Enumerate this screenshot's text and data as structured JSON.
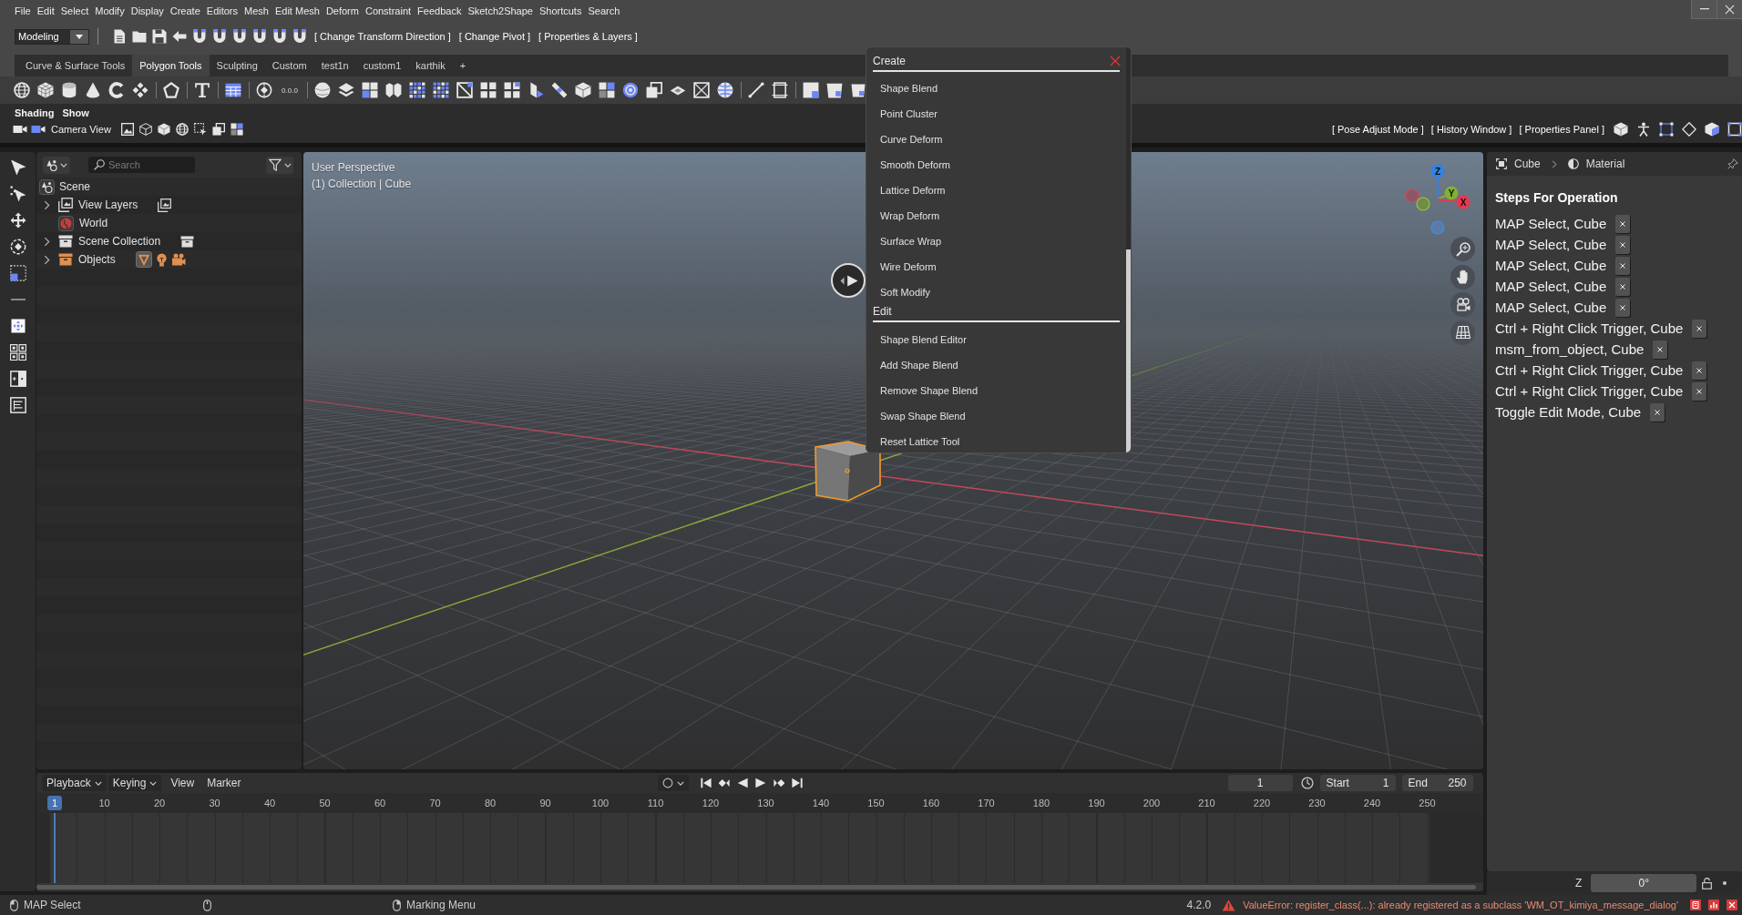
{
  "menu_bar": {
    "items": [
      "File",
      "Edit",
      "Select",
      "Modify",
      "Display",
      "Create",
      "Editors",
      "Mesh",
      "Edit Mesh",
      "Deform",
      "Constraint",
      "Feedback",
      "Sketch2Shape",
      "Shortcuts",
      "Search"
    ]
  },
  "toolbar": {
    "workspace": "Modeling",
    "actions": [
      "[ Change Transform Direction ]",
      "[ Change Pivot ]",
      "[ Properties & Layers ]"
    ]
  },
  "shelf": {
    "tabs": [
      {
        "label": "Curve & Surface Tools",
        "selected": false
      },
      {
        "label": "Polygon Tools",
        "selected": true
      },
      {
        "label": "Sculpting",
        "selected": false
      },
      {
        "label": "Custom",
        "selected": false
      },
      {
        "label": "test1n",
        "selected": false
      },
      {
        "label": "custom1",
        "selected": false
      },
      {
        "label": "karthik",
        "selected": false
      }
    ],
    "add_tab": "+",
    "coordinate_readout": "0.0.0"
  },
  "view_bar": {
    "menus": [
      "Shading",
      "Show"
    ],
    "camera_label": "Camera View",
    "panel_toggles": [
      "[ Pose Adjust Mode ]",
      "[ History Window ]",
      "[ Properties Panel ]"
    ]
  },
  "outliner": {
    "search": {
      "placeholder": "Search"
    },
    "tree": [
      {
        "label": "Scene",
        "kind": "scene",
        "children": [
          {
            "label": "View Layers",
            "kind": "view_layers",
            "expanded": false
          },
          {
            "label": "World",
            "kind": "world"
          },
          {
            "label": "Scene Collection",
            "kind": "collection",
            "expanded": false
          },
          {
            "label": "Objects",
            "kind": "objects",
            "expanded": false
          }
        ]
      }
    ]
  },
  "viewport": {
    "view_name": "User Perspective",
    "collection_label": "(1) Collection | Cube",
    "gizmo_axes": [
      {
        "label": "Z",
        "color": "#2f83e6"
      },
      {
        "label": "Y",
        "color": "#82b031"
      },
      {
        "label": "X",
        "color": "#e8374f"
      }
    ]
  },
  "create_menu": {
    "sections": [
      {
        "title": "Create",
        "items": [
          "Shape Blend",
          "Point Cluster",
          "Curve Deform",
          "Smooth Deform",
          "Lattice Deform",
          "Wrap Deform",
          "Surface Wrap",
          "Wire Deform",
          "Soft Modify"
        ]
      },
      {
        "title": "Edit",
        "items": [
          "Shape Blend Editor",
          "Add Shape Blend",
          "Remove Shape Blend",
          "Swap Shape Blend",
          "Reset Lattice Tool"
        ]
      }
    ]
  },
  "properties_panel": {
    "breadcrumb": [
      "Cube",
      "Material"
    ],
    "heading": "Steps For Operation",
    "steps": [
      "MAP Select, Cube",
      "MAP Select, Cube",
      "MAP Select, Cube",
      "MAP Select, Cube",
      "MAP Select, Cube",
      "Ctrl + Right Click Trigger, Cube",
      "msm_from_object, Cube",
      "Ctrl + Right Click Trigger, Cube",
      "Ctrl + Right Click Trigger, Cube",
      "Toggle Edit Mode, Cube"
    ]
  },
  "transform_field": {
    "label": "Z",
    "value": "0°"
  },
  "timeline": {
    "menus": [
      {
        "label": "Playback",
        "kind": "dropdown"
      },
      {
        "label": "Keying",
        "kind": "dropdown"
      },
      {
        "label": "View",
        "kind": "menu"
      },
      {
        "label": "Marker",
        "kind": "menu"
      }
    ],
    "current_frame": "1",
    "start": {
      "label": "Start",
      "value": "1"
    },
    "end": {
      "label": "End",
      "value": "250"
    },
    "playhead": "1",
    "ruler_ticks": [
      "10",
      "20",
      "30",
      "40",
      "50",
      "60",
      "70",
      "80",
      "90",
      "100",
      "110",
      "120",
      "130",
      "140",
      "150",
      "160",
      "170",
      "180",
      "190",
      "200",
      "210",
      "220",
      "230",
      "240",
      "250"
    ]
  },
  "status_bar": {
    "mouse_hints": [
      {
        "kind": "left",
        "label": "MAP Select"
      },
      {
        "kind": "middle"
      },
      {
        "kind": "right",
        "label": "Marking Menu"
      }
    ],
    "version": "4.2.0",
    "error": "ValueError: register_class(...): already registered as a subclass 'WM_OT_kimiya_message_dialog'"
  }
}
